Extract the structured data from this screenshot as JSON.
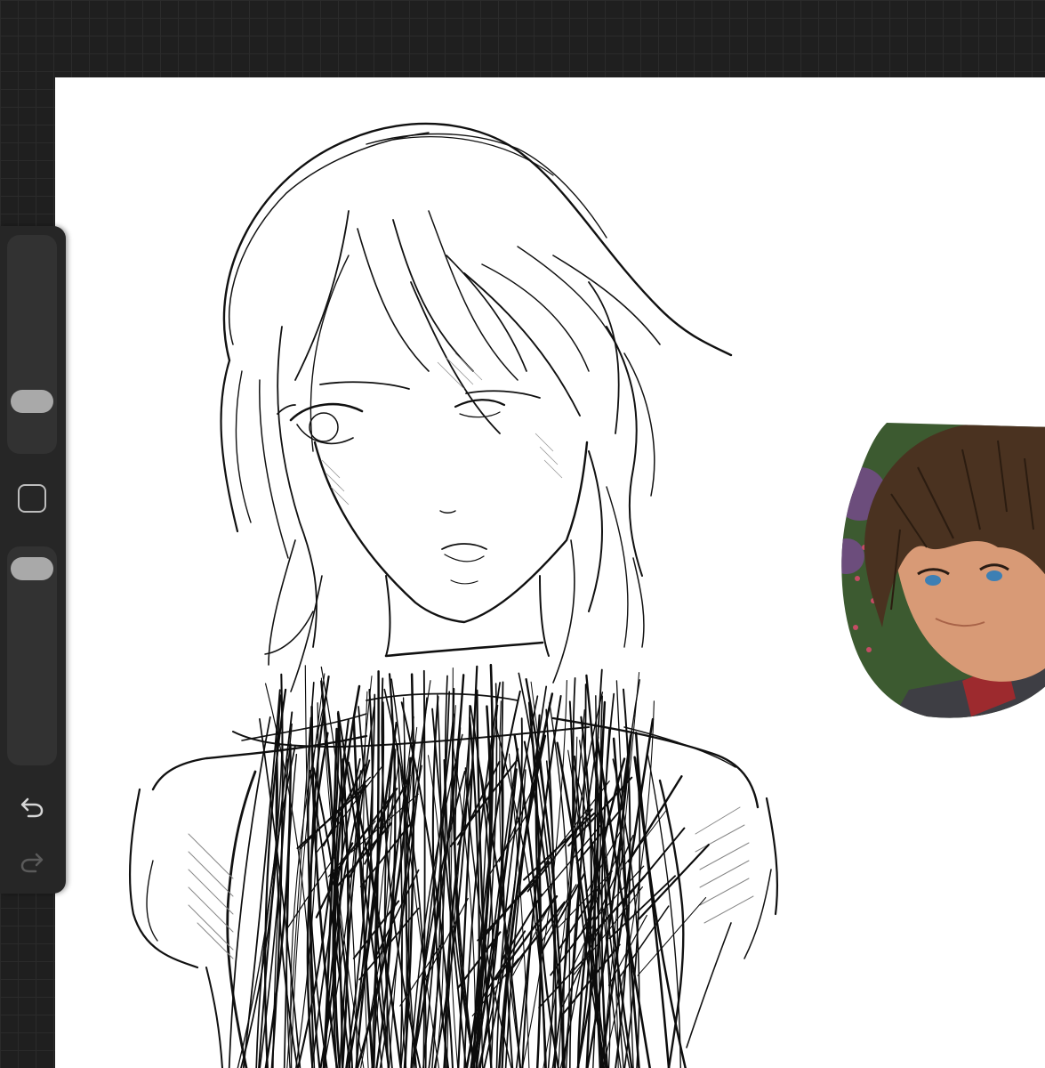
{
  "app": {
    "name": "drawing canvas",
    "background_color": "#1f1f1f",
    "canvas_color": "#ffffff"
  },
  "sidebar": {
    "brush_size_slider": {
      "value": 0.17
    },
    "modifier_button": {
      "icon": "square-icon"
    },
    "opacity_slider": {
      "value": 0.05
    },
    "undo": {
      "icon": "undo-icon"
    },
    "redo": {
      "icon": "redo-icon",
      "enabled": false
    }
  },
  "canvas": {
    "artwork": "pencil-sketch",
    "reference_image": "character-portrait"
  }
}
